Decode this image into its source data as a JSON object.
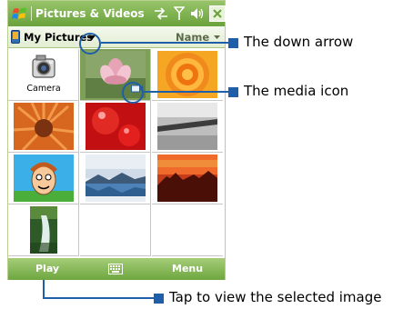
{
  "window": {
    "title": "Pictures & Videos"
  },
  "toolbar": {
    "folder": "My Pictures",
    "sort": "Name"
  },
  "grid": {
    "first_item_label": "Camera"
  },
  "softkeys": {
    "left": "Play",
    "right": "Menu"
  },
  "callouts": {
    "down_arrow": "The down arrow",
    "media_icon": "The media icon",
    "tap_hint": "Tap to view the selected image"
  },
  "colors": {
    "accent": "#1f5ea8",
    "titlebar": "#6aa23c",
    "selection": "#7d9f58"
  }
}
